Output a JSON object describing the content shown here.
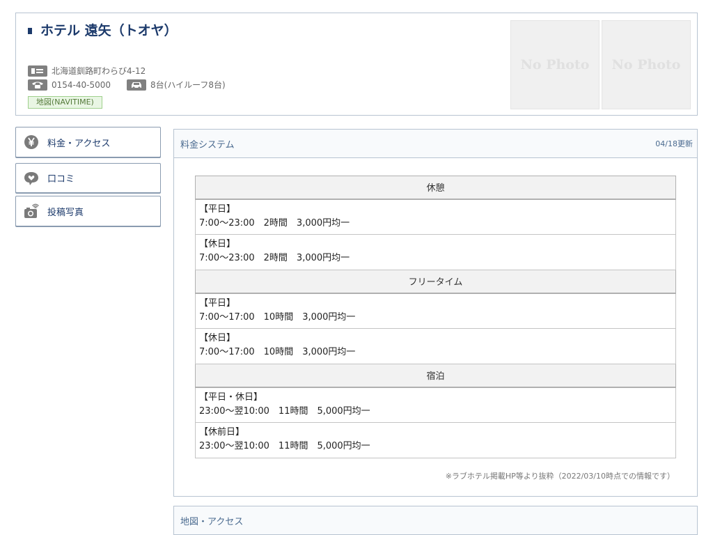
{
  "hotel": {
    "name": "ホテル 遠矢（トオヤ）",
    "address": "北海道釧路町わらび4-12",
    "phone": "0154-40-5000",
    "parking": "8台(ハイルーフ8台)",
    "map_link": "地図(NAVITIME)",
    "photos": [
      "No Photo",
      "No Photo"
    ]
  },
  "icons": {
    "address": "address-card-icon",
    "phone": "telephone-icon",
    "parking": "car-icon",
    "price": "yen-icon",
    "reviews": "heart-bubble-icon",
    "photos": "camera-icon"
  },
  "nav": {
    "items": [
      {
        "label": "料金・アクセス",
        "icon": "yen-icon"
      },
      {
        "label": "口コミ",
        "icon": "heart-bubble-icon"
      },
      {
        "label": "投稿写真",
        "icon": "camera-icon"
      }
    ]
  },
  "price_panel": {
    "title": "料金システム",
    "updated": "04/18更新",
    "sections": [
      {
        "heading": "休憩",
        "rows": [
          {
            "day": "【平日】",
            "detail": "7:00〜23:00　2時間　3,000円均一"
          },
          {
            "day": "【休日】",
            "detail": "7:00〜23:00　2時間　3,000円均一"
          }
        ]
      },
      {
        "heading": "フリータイム",
        "rows": [
          {
            "day": "【平日】",
            "detail": "7:00〜17:00　10時間　3,000円均一"
          },
          {
            "day": "【休日】",
            "detail": "7:00〜17:00　10時間　3,000円均一"
          }
        ]
      },
      {
        "heading": "宿泊",
        "rows": [
          {
            "day": "【平日・休日】",
            "detail": "23:00〜翌10:00　11時間　5,000円均一"
          },
          {
            "day": "【休前日】",
            "detail": "23:00〜翌10:00　11時間　5,000円均一"
          }
        ]
      }
    ],
    "note": "※ラブホテル掲載HP等より抜粋（2022/03/10時点での情報です）"
  },
  "access_panel": {
    "title": "地図・アクセス"
  },
  "colors": {
    "navy": "#1c3a6b",
    "link_blue": "#4a6a8f",
    "border": "#b7c3d1",
    "map_green_bg": "#e9f6e4"
  }
}
